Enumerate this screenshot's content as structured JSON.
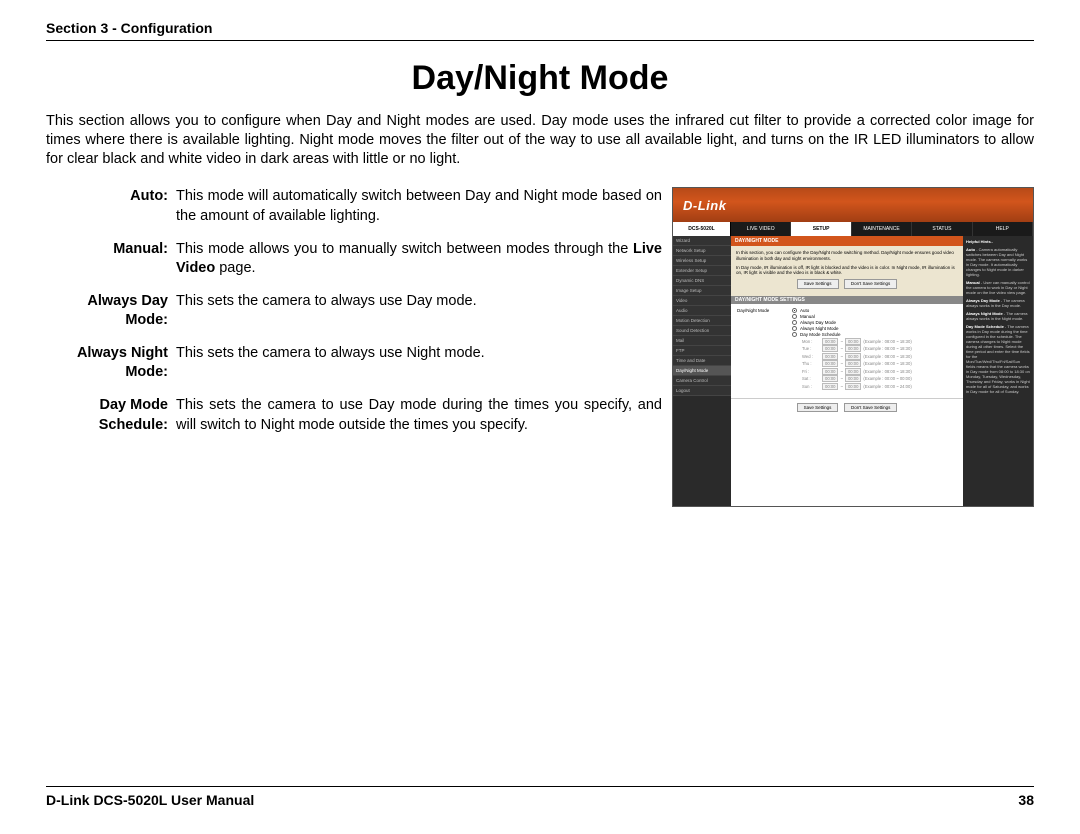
{
  "header": {
    "section": "Section 3 - Configuration"
  },
  "title": "Day/Night Mode",
  "intro": "This section allows you to configure when Day and Night modes are used. Day mode uses the infrared cut filter to provide a corrected color image for times where there is available lighting. Night mode moves the filter out of the way to use all available light, and turns on the IR LED illuminators to allow for clear black and white video in dark areas with little or no light.",
  "defs": [
    {
      "term": "Auto:",
      "desc": "This mode will automatically switch between Day and Night mode based on the amount of available lighting."
    },
    {
      "term": "Manual:",
      "desc_pre": "This mode allows you to manually switch between modes through the ",
      "bold": "Live Video",
      "desc_post": " page."
    },
    {
      "term": "Always Day Mode:",
      "desc": "This sets the camera to always use Day mode."
    },
    {
      "term": "Always Night Mode:",
      "desc": "This sets the camera to always use Night mode."
    },
    {
      "term": "Day Mode Schedule:",
      "desc": "This sets the camera to use Day mode during the times you specify, and will switch to Night mode outside the times you specify."
    }
  ],
  "shot": {
    "logo": "D-Link",
    "model": "DCS-5020L",
    "tabs": [
      "LIVE VIDEO",
      "SETUP",
      "MAINTENANCE",
      "STATUS",
      "HELP"
    ],
    "active_tab": "SETUP",
    "sidebar": [
      "Wizard",
      "Network Setup",
      "Wireless Setup",
      "Extender Setup",
      "Dynamic DNS",
      "Image Setup",
      "Video",
      "Audio",
      "Motion Detection",
      "Sound Detection",
      "Mail",
      "FTP",
      "Time and Date",
      "Day/Night Mode",
      "Camera Control",
      "Logout"
    ],
    "active_side": "Day/Night Mode",
    "heading": "DAY/NIGHT MODE",
    "info1": "In this section, you can configure the Day/Night mode switching method. Day/Night mode ensures good video illumination in both day and night environments.",
    "info2": "In Day mode, IR illumination is off, IR light is blocked and the video is in color. In Night mode, IR illumination is on, IR light is visible and the video is in black & white.",
    "btn_save": "Save Settings",
    "btn_dont": "Don't Save Settings",
    "subhead": "DAY/NIGHT MODE SETTINGS",
    "form_label": "Day/Night Mode",
    "radios": [
      "Auto",
      "Manual",
      "Always Day Mode",
      "Always Night Mode",
      "Day Mode Schedule"
    ],
    "checked_radio": "Auto",
    "schedule": [
      {
        "d": "Mon :",
        "f": "00:00",
        "t": "00:00",
        "ex": "(Example : 08:00 ~ 18:30)"
      },
      {
        "d": "Tue :",
        "f": "00:00",
        "t": "00:00",
        "ex": "(Example : 08:00 ~ 18:30)"
      },
      {
        "d": "Wed :",
        "f": "00:00",
        "t": "00:00",
        "ex": "(Example : 08:00 ~ 18:30)"
      },
      {
        "d": "Thu :",
        "f": "00:00",
        "t": "00:00",
        "ex": "(Example : 08:00 ~ 18:30)"
      },
      {
        "d": "Fri :",
        "f": "00:00",
        "t": "00:00",
        "ex": "(Example : 08:00 ~ 18:30)"
      },
      {
        "d": "Sat :",
        "f": "00:00",
        "t": "00:00",
        "ex": "(Example : 00:00 ~ 00:00)"
      },
      {
        "d": "Sun :",
        "f": "00:00",
        "t": "00:00",
        "ex": "(Example : 00:00 ~ 24:00)"
      }
    ],
    "help": {
      "title": "Helpful Hints..",
      "items": [
        {
          "b": "Auto",
          "t": " - Camera automatically switches between Day and Night mode. The camera normally works in Day mode. It automatically changes to Night mode in darker lighting."
        },
        {
          "b": "Manual",
          "t": " - User can manually control the camera to work in Day or Night mode on the live video view page."
        },
        {
          "b": "Always Day Mode",
          "t": " - The camera always works in the Day mode."
        },
        {
          "b": "Always Night Mode",
          "t": " - The camera always works in the Night mode."
        },
        {
          "b": "Day Mode Schedule",
          "t": " - The camera works in Day mode during the time configured in the schedule. The camera changes to Night mode during all other times. Select the time period and enter the time fields for the Mon/Tue/Wed/Thu/Fri/Sat/Sun fields means that the camera works in Day mode from 08:00 to 18:30 on Monday, Tuesday, Wednesday, Thursday and Friday, works in Night mode for all of Saturday, and works in Day mode for all of Sunday."
        }
      ]
    }
  },
  "footer": {
    "left": "D-Link DCS-5020L User Manual",
    "right": "38"
  }
}
